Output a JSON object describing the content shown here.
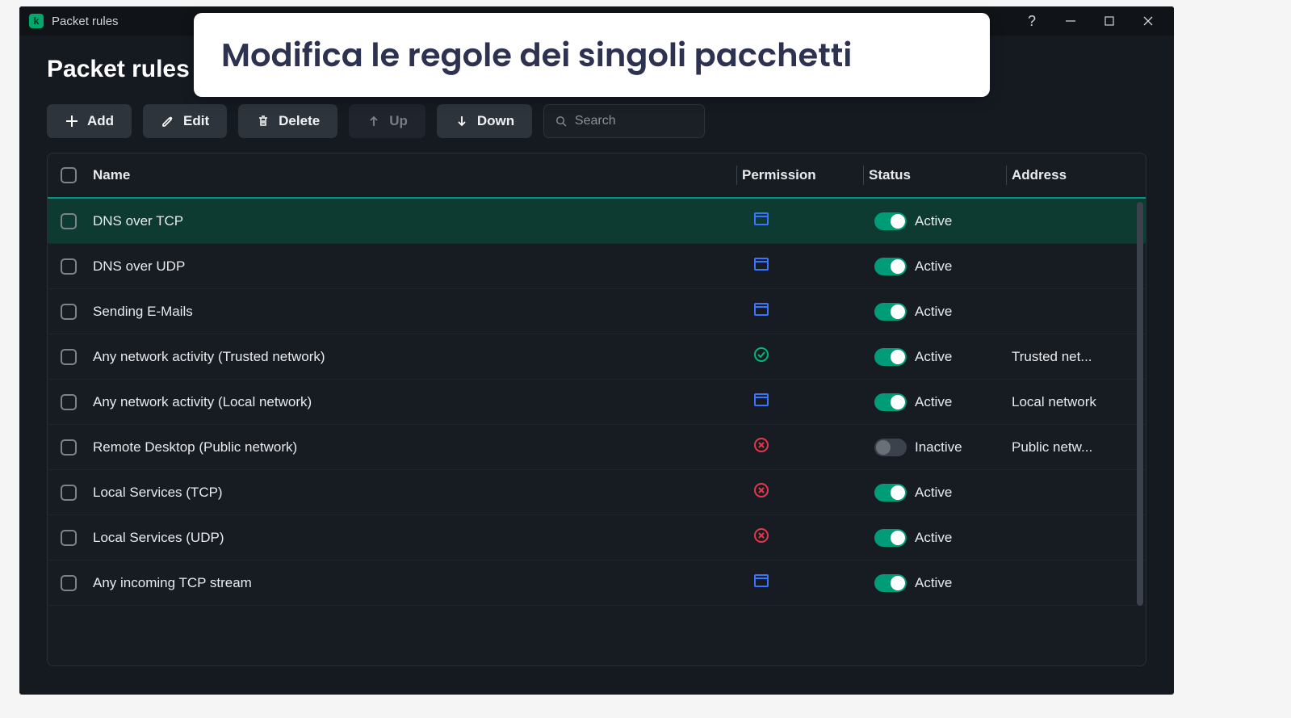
{
  "window": {
    "title": "Packet rules",
    "logo_letter": "k"
  },
  "page": {
    "heading": "Packet rules"
  },
  "toolbar": {
    "add": "Add",
    "edit": "Edit",
    "delete": "Delete",
    "up": "Up",
    "down": "Down",
    "search_placeholder": "Search"
  },
  "table": {
    "headers": {
      "name": "Name",
      "permission": "Permission",
      "status": "Status",
      "address": "Address"
    },
    "rows": [
      {
        "name": "DNS over TCP",
        "permission": "allow-window",
        "active": true,
        "status": "Active",
        "address": "",
        "selected": true
      },
      {
        "name": "DNS over UDP",
        "permission": "allow-window",
        "active": true,
        "status": "Active",
        "address": ""
      },
      {
        "name": "Sending E-Mails",
        "permission": "allow-window",
        "active": true,
        "status": "Active",
        "address": ""
      },
      {
        "name": "Any network activity (Trusted network)",
        "permission": "trusted",
        "active": true,
        "status": "Active",
        "address": "Trusted net..."
      },
      {
        "name": "Any network activity (Local network)",
        "permission": "allow-window",
        "active": true,
        "status": "Active",
        "address": "Local network"
      },
      {
        "name": "Remote Desktop (Public network)",
        "permission": "deny",
        "active": false,
        "status": "Inactive",
        "address": "Public netw..."
      },
      {
        "name": "Local Services (TCP)",
        "permission": "deny",
        "active": true,
        "status": "Active",
        "address": ""
      },
      {
        "name": "Local Services (UDP)",
        "permission": "deny",
        "active": true,
        "status": "Active",
        "address": ""
      },
      {
        "name": "Any incoming TCP stream",
        "permission": "allow-window",
        "active": true,
        "status": "Active",
        "address": ""
      }
    ]
  },
  "callout": {
    "text": "Modifica le regole dei singoli pacchetti"
  }
}
